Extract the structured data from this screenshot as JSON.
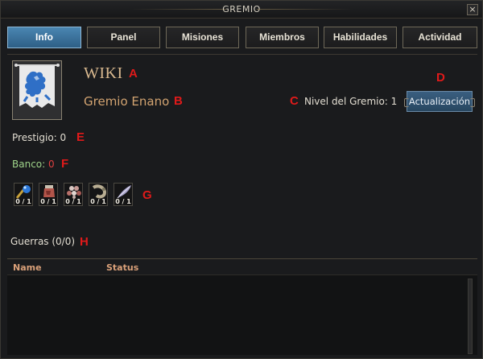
{
  "window": {
    "title": "GREMIO",
    "close_label": "×"
  },
  "tabs": [
    {
      "label": "Info",
      "active": true
    },
    {
      "label": "Panel",
      "active": false
    },
    {
      "label": "Misiones",
      "active": false
    },
    {
      "label": "Miembros",
      "active": false
    },
    {
      "label": "Habilidades",
      "active": false
    },
    {
      "label": "Actividad",
      "active": false
    }
  ],
  "guild": {
    "emblem_icon": "blue-lion-rampant-banner-icon",
    "name": "WIKI",
    "race": "Gremio Enano",
    "level_label": "Nivel del Gremio: 1",
    "upgrade_label": "Actualización"
  },
  "stats": {
    "prestige_label": "Prestigio: 0",
    "bank_label": "Banco:",
    "bank_value": "0"
  },
  "resources": [
    {
      "icon": "blue-orb-icon",
      "count": "0 / 1"
    },
    {
      "icon": "red-flask-icon",
      "count": "0 / 1"
    },
    {
      "icon": "gem-cluster-icon",
      "count": "0 / 1"
    },
    {
      "icon": "horn-icon",
      "count": "0 / 1"
    },
    {
      "icon": "feather-quill-icon",
      "count": "0 / 1"
    }
  ],
  "wars": {
    "label": "Guerras (0/0)",
    "columns": [
      "Name",
      "Status"
    ],
    "rows": []
  },
  "markers": [
    "A",
    "B",
    "C",
    "D",
    "E",
    "F",
    "G",
    "H"
  ],
  "colors": {
    "active_tab": "#3f7aa8",
    "marker_red": "#e01a1a",
    "guild_name": "#d9b98f",
    "bank_green": "#9fd48a",
    "column_header": "#d9a079"
  }
}
